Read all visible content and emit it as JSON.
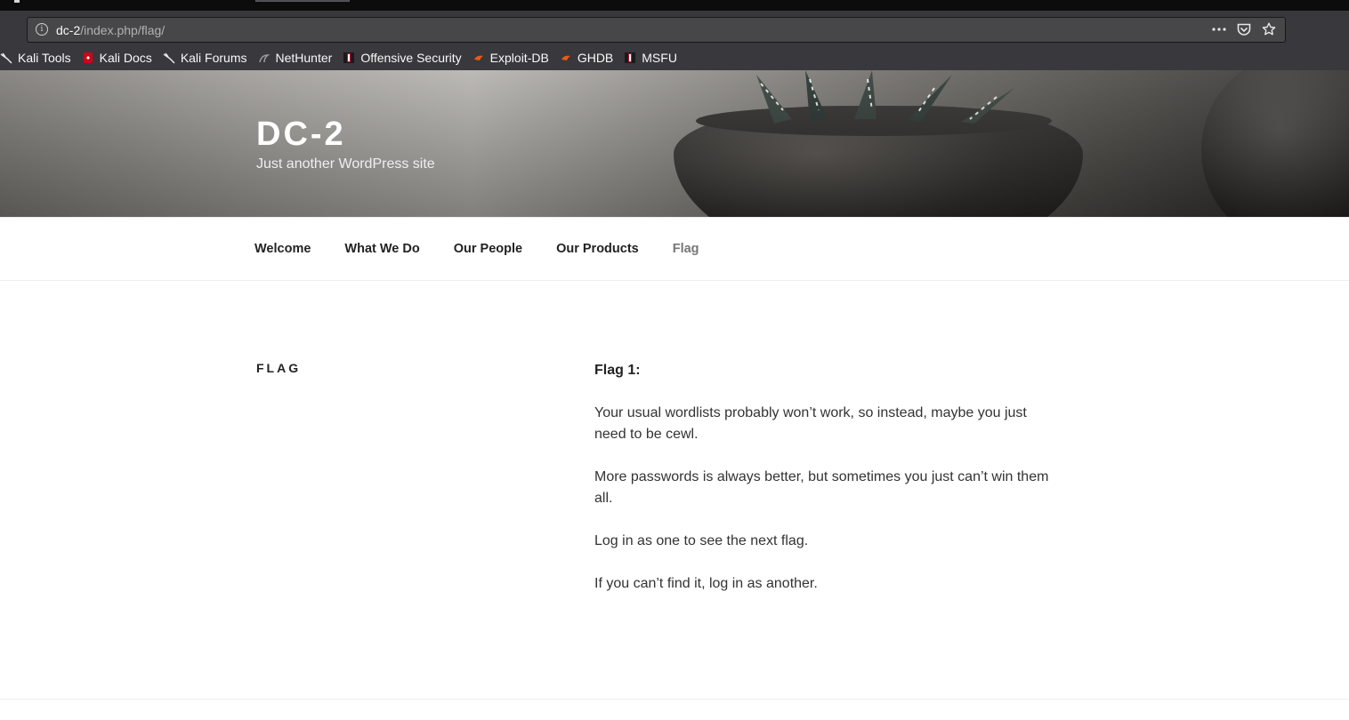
{
  "browser": {
    "url_host": "dc-2",
    "url_path": "/index.php/flag/",
    "actions": [
      "more-icon",
      "pocket-icon",
      "star-icon"
    ],
    "bookmarks": [
      {
        "label": "Kali Tools",
        "icon": "kali-dragon-icon"
      },
      {
        "label": "Kali Docs",
        "icon": "kali-docs-icon"
      },
      {
        "label": "Kali Forums",
        "icon": "kali-dragon-icon"
      },
      {
        "label": "NetHunter",
        "icon": "nethunter-icon"
      },
      {
        "label": "Offensive Security",
        "icon": "offsec-icon"
      },
      {
        "label": "Exploit-DB",
        "icon": "exploitdb-icon"
      },
      {
        "label": "GHDB",
        "icon": "exploitdb-icon"
      },
      {
        "label": "MSFU",
        "icon": "offsec-icon"
      }
    ]
  },
  "site": {
    "title": "DC-2",
    "description": "Just another WordPress site"
  },
  "nav": {
    "items": [
      {
        "label": "Welcome",
        "current": false
      },
      {
        "label": "What We Do",
        "current": false
      },
      {
        "label": "Our People",
        "current": false
      },
      {
        "label": "Our Products",
        "current": false
      },
      {
        "label": "Flag",
        "current": true
      }
    ]
  },
  "page": {
    "title": "FLAG",
    "heading": "Flag 1:",
    "paragraphs": [
      "Your usual wordlists probably won’t work, so instead, maybe you just need to be cewl.",
      "More passwords is always better, but sometimes you just can’t win them all.",
      "Log in as one to see the next flag.",
      "If you can’t find it, log in as another."
    ]
  },
  "colors": {
    "chrome_bg": "#38383d",
    "urlbar_bg": "#474749",
    "nav_current": "#767676",
    "text": "#333333"
  }
}
